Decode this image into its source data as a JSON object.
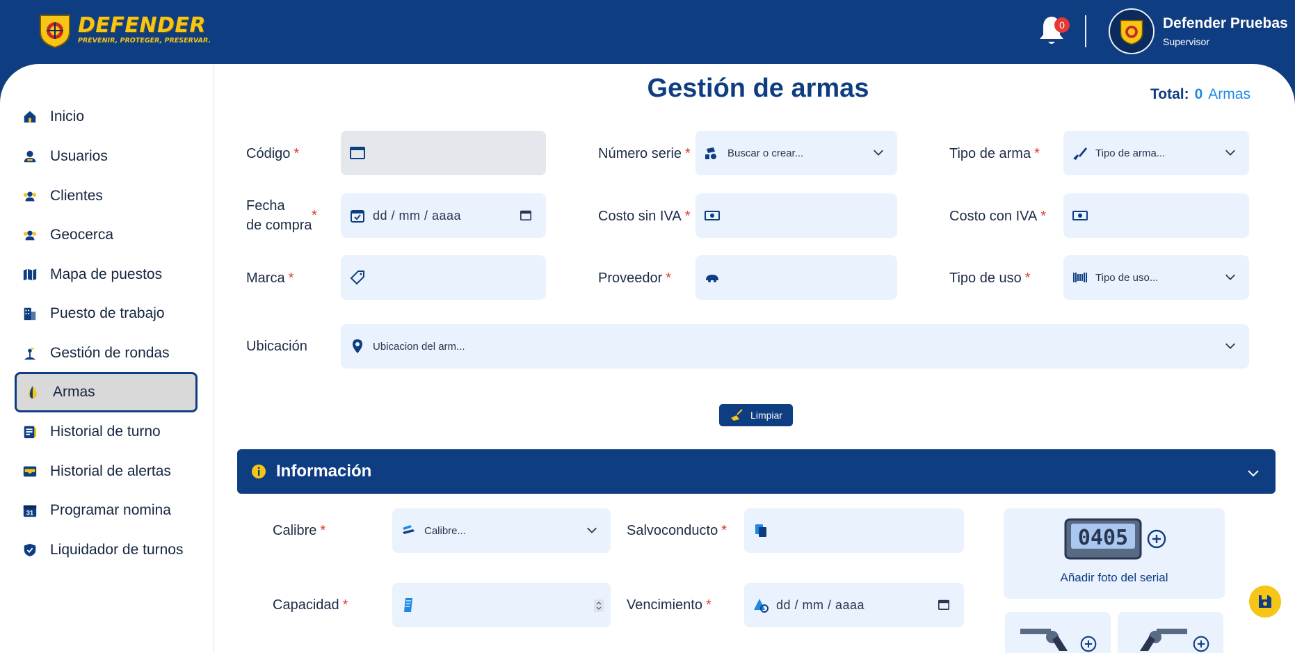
{
  "header": {
    "logo_title": "DEFENDER",
    "logo_subtitle": "PREVENIR, PROTEGER, PRESERVAR.",
    "notification_count": "0",
    "user_name": "Defender Pruebas",
    "user_role": "Supervisor"
  },
  "sidebar": {
    "items": [
      {
        "label": "Inicio",
        "icon": "home-icon"
      },
      {
        "label": "Usuarios",
        "icon": "user-icon"
      },
      {
        "label": "Clientes",
        "icon": "users-icon"
      },
      {
        "label": "Geocerca",
        "icon": "users-icon"
      },
      {
        "label": "Mapa de puestos",
        "icon": "map-icon"
      },
      {
        "label": "Puesto de trabajo",
        "icon": "building-icon"
      },
      {
        "label": "Gestión de rondas",
        "icon": "round-icon"
      },
      {
        "label": "Armas",
        "icon": "weapon-icon",
        "active": true
      },
      {
        "label": "Historial de turno",
        "icon": "history-icon"
      },
      {
        "label": "Historial de alertas",
        "icon": "inbox-icon"
      },
      {
        "label": "Programar nomina",
        "icon": "calendar-icon"
      },
      {
        "label": "Liquidador de turnos",
        "icon": "shield-icon"
      }
    ]
  },
  "main": {
    "title": "Gestión de armas",
    "total_label": "Total:",
    "total_value": "0",
    "total_unit": "Armas",
    "required_mark": "*",
    "fields": {
      "codigo": {
        "label": "Código",
        "value": ""
      },
      "numero_serie": {
        "label": "Número serie",
        "placeholder": "Buscar o crear..."
      },
      "tipo_arma": {
        "label": "Tipo de arma",
        "placeholder": "Tipo de arma..."
      },
      "fecha_compra": {
        "label_line1": "Fecha",
        "label_line2": "de compra",
        "placeholder": "dd / mm / aaaa"
      },
      "costo_sin_iva": {
        "label": "Costo sin IVA",
        "value": ""
      },
      "costo_con_iva": {
        "label": "Costo con IVA",
        "value": ""
      },
      "marca": {
        "label": "Marca",
        "value": ""
      },
      "proveedor": {
        "label": "Proveedor",
        "value": ""
      },
      "tipo_uso": {
        "label": "Tipo de uso",
        "placeholder": "Tipo de uso..."
      },
      "ubicacion": {
        "label": "Ubicación",
        "placeholder": "Ubicacion del arm..."
      }
    },
    "clear_button": "Limpiar",
    "info_section": {
      "title": "Información",
      "calibre": {
        "label": "Calibre",
        "placeholder": "Calibre..."
      },
      "salvoconducto": {
        "label": "Salvoconducto",
        "value": ""
      },
      "capacidad": {
        "label": "Capacidad",
        "value": ""
      },
      "vencimiento": {
        "label": "Vencimiento",
        "placeholder": "dd / mm / aaaa"
      },
      "serial_photo_caption": "Añadir foto del serial",
      "serial_digits": "0405"
    }
  },
  "colors": {
    "primary": "#0f3d82",
    "accent_yellow": "#f6c515",
    "field_bg": "#eaf2fd",
    "required": "#e53935",
    "link_blue": "#1e88e5"
  }
}
